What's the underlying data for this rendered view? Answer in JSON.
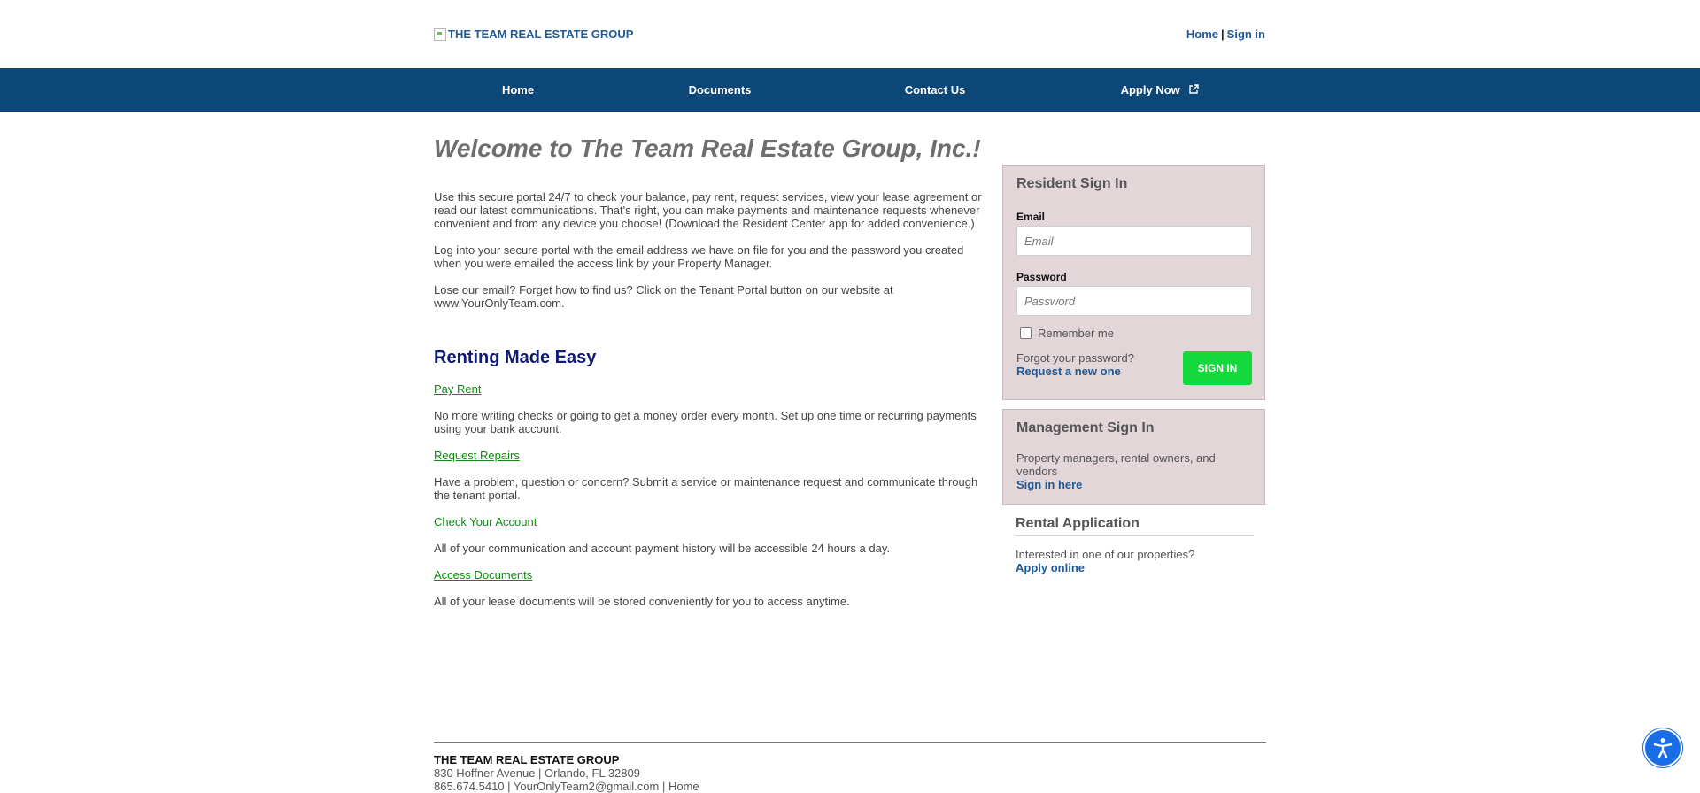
{
  "header": {
    "logo_alt": "THE TEAM REAL ESTATE GROUP",
    "links": {
      "home": "Home",
      "separator": "|",
      "sign_in": "Sign in"
    }
  },
  "nav": {
    "items": [
      {
        "label": "Home"
      },
      {
        "label": "Documents"
      },
      {
        "label": "Contact Us"
      },
      {
        "label": "Apply Now",
        "icon": "external-link-icon"
      }
    ]
  },
  "main": {
    "welcome_title": "Welcome to The Team Real Estate Group, Inc.!",
    "intro_paragraphs": [
      "Use this secure portal 24/7 to check your balance, pay rent, request services, view your lease agreement or read our latest communications. That's right, you can make payments and maintenance requests whenever convenient and from any device you choose! (Download the Resident Center app for added convenience.)",
      "Log into your secure portal with the email address we have on file for you and the password you created when you were emailed the access link by your Property Manager.",
      "Lose our email? Forget how to find us? Click on the Tenant Portal button on our website at www.YourOnlyTeam.com."
    ],
    "section_title": "Renting Made Easy",
    "features": [
      {
        "link": "Pay Rent",
        "desc": "No more writing checks or going to get a money order every month. Set up one time or recurring payments using your bank account."
      },
      {
        "link": "Request Repairs",
        "desc": "Have a problem, question or concern? Submit a service or maintenance request and communicate through the tenant portal."
      },
      {
        "link": "Check Your Account",
        "desc": "All of your communication and account payment history will be accessible 24 hours a day."
      },
      {
        "link": "Access Documents",
        "desc": "All of your lease documents will be stored conveniently for you to access anytime."
      }
    ]
  },
  "resident_signin": {
    "title": "Resident Sign In",
    "email_label": "Email",
    "email_placeholder": "Email",
    "password_label": "Password",
    "password_placeholder": "Password",
    "remember_label": "Remember me",
    "remember_checked": false,
    "forgot_text": "Forgot your password?",
    "forgot_link": "Request a new one",
    "signin_button": "SIGN IN"
  },
  "management_signin": {
    "title": "Management Sign In",
    "text": "Property managers, rental owners, and vendors",
    "link": "Sign in here"
  },
  "rental_application": {
    "title": "Rental Application",
    "text": "Interested in one of our properties?",
    "link": "Apply online"
  },
  "footer": {
    "company": "THE TEAM REAL ESTATE GROUP",
    "address": "830 Hoffner Avenue | Orlando, FL 32809",
    "contact": "865.674.5410 | YourOnlyTeam2@gmail.com | Home"
  },
  "colors": {
    "nav_bg": "#0d4777",
    "link_blue": "#1f5a96",
    "feature_link_green": "#0f8a0f",
    "panel_bg": "#e2d6d8",
    "signin_button_bg": "#14d93c",
    "section_title": "#0e1a73",
    "accessibility_button": "#1a6ee5"
  },
  "accessibility": {
    "icon": "accessibility-icon"
  }
}
